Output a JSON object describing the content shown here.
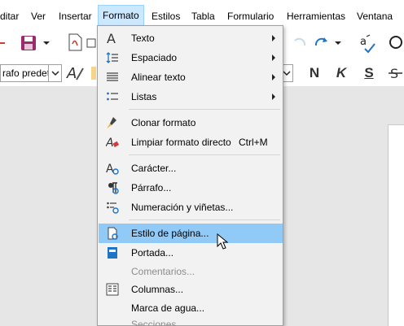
{
  "menubar": {
    "items": [
      "ditar",
      "Ver",
      "Insertar",
      "Formato",
      "Estilos",
      "Tabla",
      "Formulario",
      "Herramientas",
      "Ventana"
    ],
    "active": "Formato"
  },
  "toolbar": {
    "paragraph_style_value": "rafo predet",
    "format_buttons": [
      "N",
      "K",
      "S"
    ]
  },
  "menu": {
    "items": [
      {
        "label": "Texto",
        "icon": "text-icon",
        "submenu": true
      },
      {
        "label": "Espaciado",
        "icon": "spacing-icon",
        "submenu": true
      },
      {
        "label": "Alinear texto",
        "icon": "align-icon",
        "submenu": true
      },
      {
        "label": "Listas",
        "icon": "list-icon",
        "submenu": true
      },
      {
        "label": "Clonar formato",
        "icon": "clone-format-icon"
      },
      {
        "label": "Limpiar formato directo",
        "icon": "clear-format-icon",
        "shortcut": "Ctrl+M"
      },
      {
        "label": "Carácter...",
        "icon": "character-icon"
      },
      {
        "label": "Párrafo...",
        "icon": "paragraph-icon"
      },
      {
        "label": "Numeración y viñetas...",
        "icon": "bullets-icon"
      },
      {
        "label": "Estilo de página...",
        "icon": "page-style-icon",
        "highlighted": true
      },
      {
        "label": "Portada...",
        "icon": "title-page-icon"
      },
      {
        "label": "Comentarios...",
        "disabled": true
      },
      {
        "label": "Columnas...",
        "icon": "columns-icon"
      },
      {
        "label": "Marca de agua..."
      },
      {
        "label": "Secciones...",
        "disabled": true
      }
    ]
  },
  "colors": {
    "highlight": "#91c9f7",
    "menu_bg": "#f2f2f2",
    "active_menu": "#cce8ff",
    "disabled_text": "#8c8c8c"
  }
}
